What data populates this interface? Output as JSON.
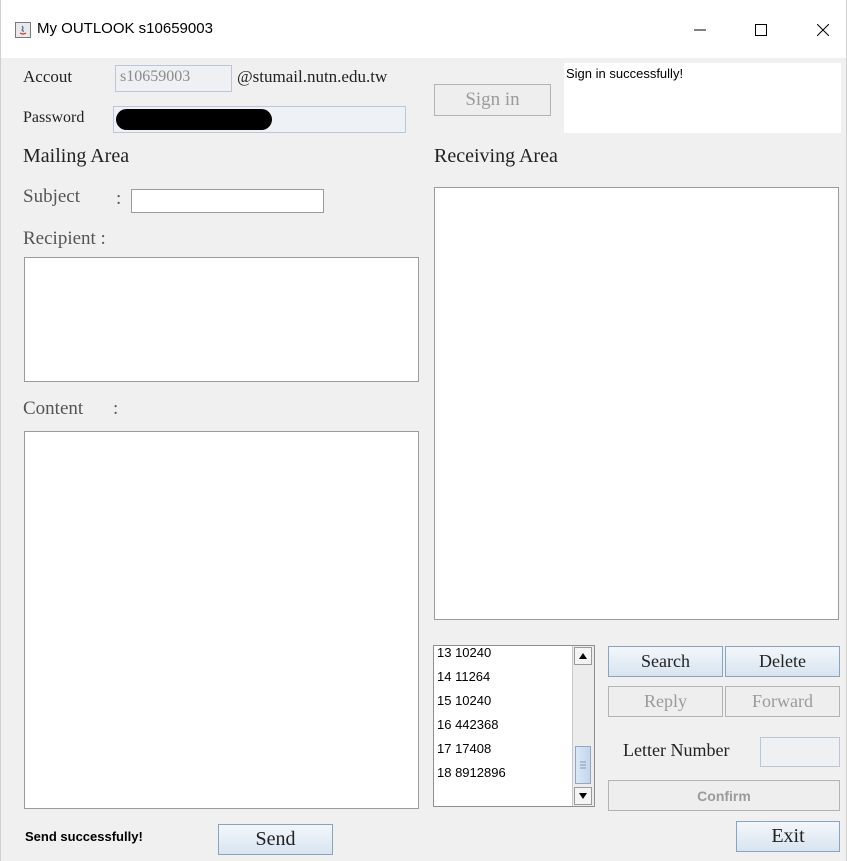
{
  "window": {
    "title": "My OUTLOOK s10659003",
    "minimize_symbol": "—",
    "maximize_symbol": "☐",
    "close_symbol": "✕"
  },
  "account": {
    "account_label": "Accout",
    "account_value": "s10659003",
    "domain": "@stumail.nutn.edu.tw",
    "password_label": "Password",
    "sign_in_label": "Sign in",
    "status_message": "Sign in successfully!"
  },
  "mailing": {
    "heading": "Mailing Area",
    "subject_label": "Subject",
    "subject_colon": ":",
    "subject_value": "",
    "recipient_label": "Recipient :",
    "content_label": "Content",
    "content_colon": ":",
    "send_status": "Send successfully!",
    "send_label": "Send"
  },
  "receiving": {
    "heading": "Receiving Area",
    "letters": [
      "13 10240",
      "14 11264",
      "15 10240",
      "16 442368",
      "17 17408",
      "18 8912896"
    ],
    "search_label": "Search",
    "delete_label": "Delete",
    "reply_label": "Reply",
    "forward_label": "Forward",
    "letter_number_label": "Letter Number",
    "confirm_label": "Confirm",
    "exit_label": "Exit"
  },
  "colors": {
    "window_bg": "#f0f0f0",
    "button_border": "#8aa3bf",
    "disabled_text": "#9a9a9a"
  }
}
